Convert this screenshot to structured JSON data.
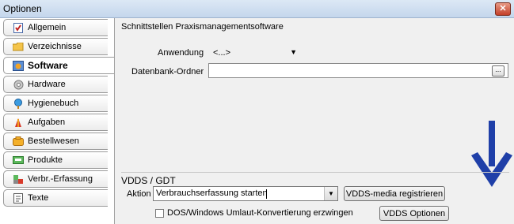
{
  "window": {
    "title": "Optionen",
    "close_label": "✕"
  },
  "sidebar": {
    "items": [
      {
        "label": "Allgemein",
        "icon": "checklist-icon"
      },
      {
        "label": "Verzeichnisse",
        "icon": "folder-icon"
      },
      {
        "label": "Software",
        "icon": "software-icon",
        "active": true
      },
      {
        "label": "Hardware",
        "icon": "gear-icon"
      },
      {
        "label": "Hygienebuch",
        "icon": "pin-icon"
      },
      {
        "label": "Aufgaben",
        "icon": "tasks-icon"
      },
      {
        "label": "Bestellwesen",
        "icon": "order-icon"
      },
      {
        "label": "Produkte",
        "icon": "products-icon"
      },
      {
        "label": "Verbr.-Erfassung",
        "icon": "consumption-icon"
      },
      {
        "label": "Texte",
        "icon": "texts-icon"
      }
    ]
  },
  "main": {
    "section_title": "Schnittstellen Praxismanagementsoftware",
    "anwendung_label": "Anwendung",
    "anwendung_value": "<...>",
    "db_folder_label": "Datenbank-Ordner",
    "db_folder_value": "",
    "browse_label": "...",
    "vdds": {
      "title": "VDDS / GDT",
      "aktion_label": "Aktion",
      "aktion_value": "Verbrauchserfassung starten",
      "register_button": "VDDS-media registrieren",
      "umlaut_checkbox_label": "DOS/Windows Umlaut-Konvertierung erzwingen",
      "umlaut_checked": false,
      "options_button": "VDDS Optionen"
    }
  },
  "colors": {
    "arrow": "#1f3fa8",
    "titlebar": "#c4d6ec",
    "panel": "#f0f0f0"
  }
}
